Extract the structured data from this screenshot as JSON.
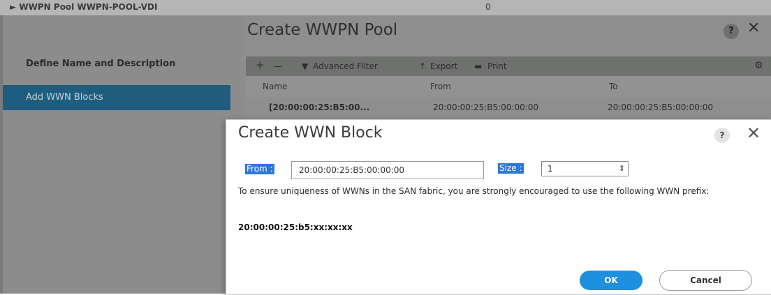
{
  "background": {
    "breadcrumb": "► WWPN Pool WWPN-POOL-VDI",
    "count": "0",
    "wizard": {
      "title": "Create WWPN Pool",
      "help": "?",
      "close": "✕",
      "steps": [
        "Define Name and Description",
        "Add WWN Blocks"
      ],
      "toolbar": {
        "add": "+",
        "remove": "—",
        "filter": "Advanced Filter",
        "export": "Export",
        "print": "Print",
        "settings": "⚙"
      },
      "table": {
        "columns": [
          "Name",
          "From",
          "To"
        ],
        "rows": [
          [
            "[20:00:00:25:B5:00...",
            "20:00:00:25:B5:00:00:00",
            "20:00:00:25:B5:00:00:00"
          ]
        ]
      }
    }
  },
  "modal": {
    "title": "Create WWN Block",
    "help": "?",
    "close": "✕",
    "from_label": "From :",
    "from_value": "20:00:00:25:B5:00:00:00",
    "size_label": "Size :",
    "size_value": "1",
    "message": "To ensure uniqueness of WWNs in the SAN fabric, you are strongly encouraged to use the following WWN prefix:",
    "prefix": "20:00:00:25:b5:xx:xx:xx",
    "ok": "OK",
    "cancel": "Cancel"
  }
}
